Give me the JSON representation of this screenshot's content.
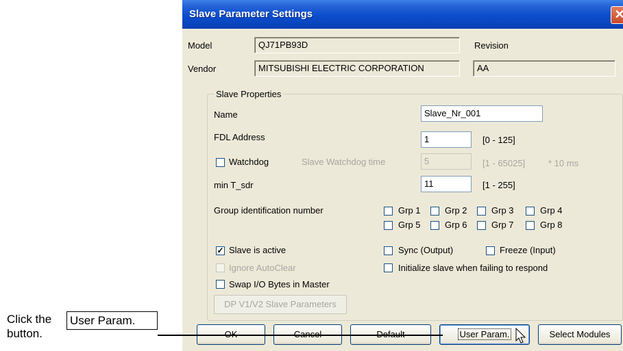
{
  "annotation": {
    "prefix": "Click the",
    "button_label": "User Param.",
    "suffix": "button."
  },
  "window": {
    "title": "Slave Parameter Settings",
    "close_glyph": "✕"
  },
  "header": {
    "model_label": "Model",
    "model_value": "QJ71PB93D",
    "revision_label": "Revision",
    "vendor_label": "Vendor",
    "vendor_value": "MITSUBISHI ELECTRIC CORPORATION",
    "revision_value": "AA"
  },
  "slave_properties": {
    "group_title": "Slave Properties",
    "name_label": "Name",
    "name_value": "Slave_Nr_001",
    "fdl_label": "FDL Address",
    "fdl_value": "1",
    "fdl_range": "[0 - 125]",
    "watchdog_label": "Watchdog",
    "watchdog_checked": false,
    "watchdog_time_label": "Slave Watchdog time",
    "watchdog_time_value": "5",
    "watchdog_range": "[1 - 65025]",
    "watchdog_unit": "* 10 ms",
    "min_tsdr_label": "min T_sdr",
    "min_tsdr_value": "11",
    "min_tsdr_range": "[1 - 255]",
    "group_id_label": "Group identification number",
    "groups": [
      "Grp 1",
      "Grp 2",
      "Grp 3",
      "Grp 4",
      "Grp 5",
      "Grp 6",
      "Grp 7",
      "Grp 8"
    ],
    "slave_active_label": "Slave is active",
    "slave_active_checked": true,
    "sync_label": "Sync (Output)",
    "freeze_label": "Freeze (Input)",
    "ignore_autoclear_label": "Ignore AutoClear",
    "init_slave_label": "Initialize slave when failing to respond",
    "swap_io_label": "Swap I/O Bytes in Master",
    "dp_v1v2_button": "DP V1/V2 Slave Parameters"
  },
  "buttons": {
    "ok": "OK",
    "cancel": "Cancel",
    "default": "Default",
    "user_param": "User Param.",
    "select_modules": "Select Modules"
  },
  "colors": {
    "title_bar": "#0a4dcc",
    "dialog_bg": "#ece9d8",
    "close_button": "#c84a2a"
  }
}
